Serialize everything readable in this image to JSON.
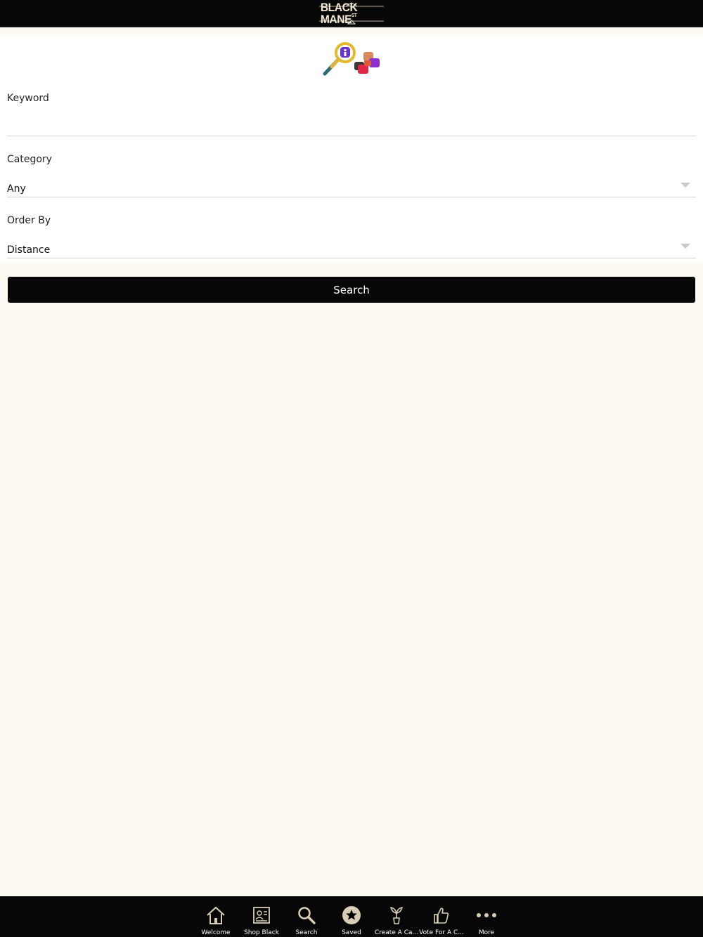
{
  "header": {
    "logo_text": "BLACK MANE",
    "logo_superscript": "ST"
  },
  "form": {
    "keyword": {
      "label": "Keyword",
      "value": ""
    },
    "category": {
      "label": "Category",
      "selected": "Any"
    },
    "order_by": {
      "label": "Order By",
      "selected": "Distance"
    },
    "search_button": "Search"
  },
  "tabbar": {
    "items": [
      {
        "label": "Welcome",
        "icon": "home-icon"
      },
      {
        "label": "Shop Black",
        "icon": "id-card-icon"
      },
      {
        "label": "Search",
        "icon": "search-icon"
      },
      {
        "label": "Saved",
        "icon": "star-icon"
      },
      {
        "label": "Create A Ca...",
        "icon": "plant-icon"
      },
      {
        "label": "Vote For A C...",
        "icon": "thumbs-up-icon"
      },
      {
        "label": "More",
        "icon": "more-dots-icon"
      }
    ]
  },
  "colors": {
    "bar_background": "#070707",
    "page_background": "#fdf9f3",
    "icon_tint": "#d9cdb4",
    "button_text": "#ffffff"
  }
}
